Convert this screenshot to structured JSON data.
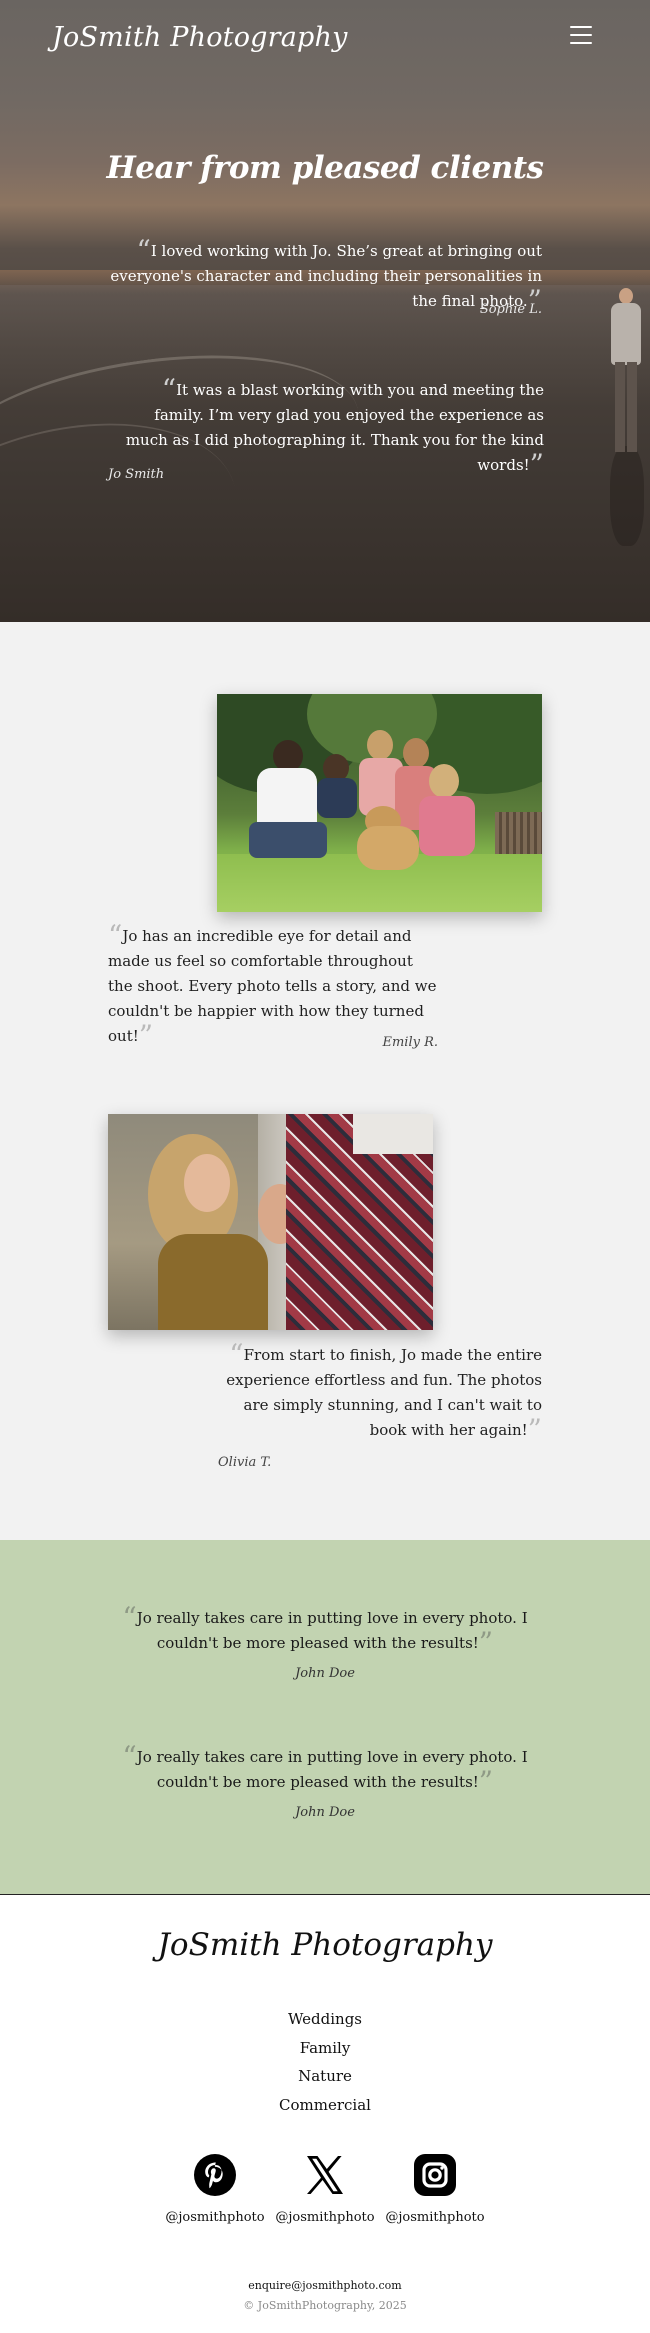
{
  "header": {
    "brand": "JoSmith Photography",
    "menu_icon": "hamburger-menu-icon"
  },
  "hero": {
    "heading": "Hear from pleased clients",
    "testimonials": [
      {
        "text": "I loved working with Jo. She’s great at bringing out everyone's character and including their personalities in the final photo.",
        "author": "Sophie L."
      },
      {
        "text": "It was a blast working with you and meeting the family. I’m very glad you enjoyed the experience as much as I did photographing it. Thank you for the kind words!",
        "author": "Jo Smith"
      }
    ]
  },
  "photo_testimonials": [
    {
      "photo": "family-with-dog-photo",
      "text": "Jo has an incredible eye for detail and made us feel so comfortable throughout the shoot. Every photo tells a story, and we couldn't be happier with how they turned out!",
      "author": "Emily R."
    },
    {
      "photo": "couple-holding-hands-photo",
      "text": "From start to finish, Jo made the entire experience effortless and fun. The photos are simply stunning, and I can't wait to book with her again!",
      "author": "Olivia T."
    }
  ],
  "green_testimonials": [
    {
      "text": "Jo really takes care in putting love in every photo. I couldn't be more pleased with the results!",
      "author": "John Doe"
    },
    {
      "text": "Jo really takes care in putting love in every photo. I couldn't be more pleased with the results!",
      "author": "John Doe"
    }
  ],
  "footer": {
    "brand": "JoSmith Photography",
    "nav": [
      "Weddings",
      "Family",
      "Nature",
      "Commercial"
    ],
    "socials": [
      {
        "icon": "pinterest-icon",
        "handle": "@josmithphoto"
      },
      {
        "icon": "x-icon",
        "handle": "@josmithphoto"
      },
      {
        "icon": "instagram-icon",
        "handle": "@josmithphoto"
      }
    ],
    "email": "enquire@josmithphoto.com",
    "copyright": "© JoSmithPhotography, 2025"
  },
  "colors": {
    "green_section": "#c2d3b1",
    "light_section": "#f2f2f2",
    "hero_text": "#ffffff"
  }
}
